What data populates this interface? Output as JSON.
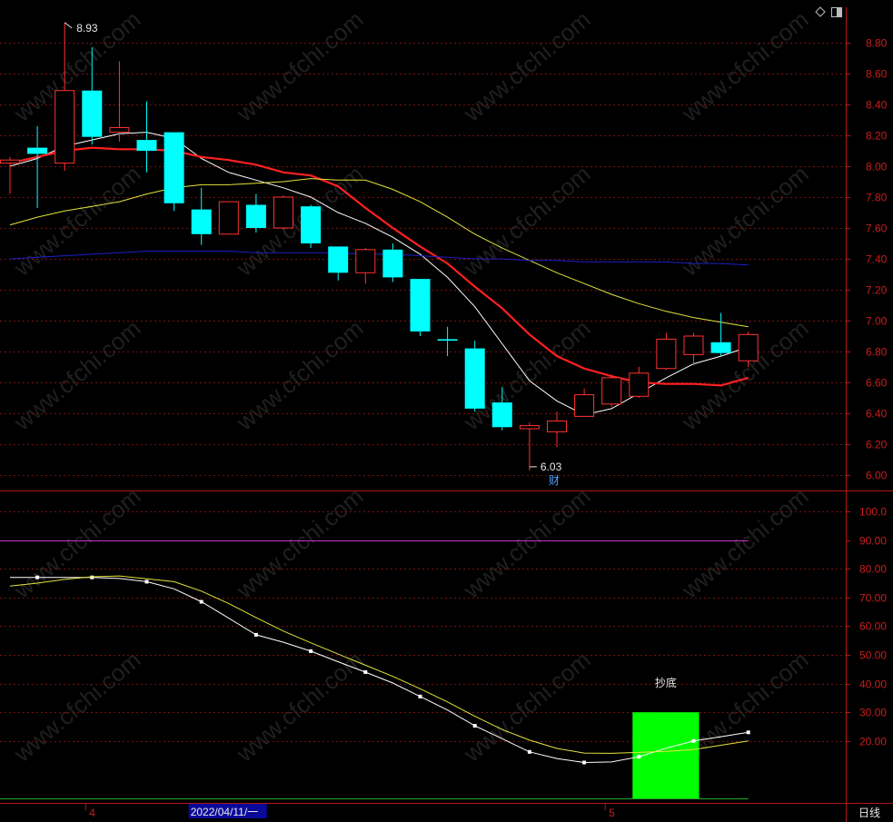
{
  "chart_data": [
    {
      "type": "candlestick",
      "y_ticks": [
        "8.80",
        "8.60",
        "8.40",
        "8.20",
        "8.00",
        "7.80",
        "7.60",
        "7.40",
        "7.20",
        "7.00",
        "6.80",
        "6.60",
        "6.40",
        "6.20",
        "6.00"
      ],
      "ylim": [
        5.97,
        9.05
      ],
      "high_label": "8.93",
      "low_label": "6.03",
      "marker_label": "财",
      "candles": [
        {
          "o": 8.02,
          "h": 8.06,
          "l": 7.82,
          "c": 8.04
        },
        {
          "o": 8.12,
          "h": 8.26,
          "l": 7.73,
          "c": 8.08
        },
        {
          "o": 8.02,
          "h": 8.93,
          "l": 7.97,
          "c": 8.49
        },
        {
          "o": 8.49,
          "h": 8.77,
          "l": 8.14,
          "c": 8.19
        },
        {
          "o": 8.22,
          "h": 8.68,
          "l": 8.16,
          "c": 8.25
        },
        {
          "o": 8.17,
          "h": 8.42,
          "l": 7.96,
          "c": 8.1
        },
        {
          "o": 8.22,
          "h": 8.22,
          "l": 7.71,
          "c": 7.76
        },
        {
          "o": 7.72,
          "h": 7.86,
          "l": 7.49,
          "c": 7.56
        },
        {
          "o": 7.56,
          "h": 7.77,
          "l": 7.56,
          "c": 7.77
        },
        {
          "o": 7.75,
          "h": 7.82,
          "l": 7.57,
          "c": 7.6
        },
        {
          "o": 7.6,
          "h": 7.81,
          "l": 7.59,
          "c": 7.8
        },
        {
          "o": 7.74,
          "h": 7.75,
          "l": 7.47,
          "c": 7.5
        },
        {
          "o": 7.48,
          "h": 7.48,
          "l": 7.26,
          "c": 7.31
        },
        {
          "o": 7.31,
          "h": 7.47,
          "l": 7.24,
          "c": 7.46
        },
        {
          "o": 7.46,
          "h": 7.5,
          "l": 7.25,
          "c": 7.28
        },
        {
          "o": 7.27,
          "h": 7.27,
          "l": 6.9,
          "c": 6.93
        },
        {
          "o": 6.88,
          "h": 6.96,
          "l": 6.77,
          "c": 6.87
        },
        {
          "o": 6.82,
          "h": 6.87,
          "l": 6.41,
          "c": 6.43
        },
        {
          "o": 6.47,
          "h": 6.57,
          "l": 6.29,
          "c": 6.31
        },
        {
          "o": 6.3,
          "h": 6.34,
          "l": 6.03,
          "c": 6.32
        },
        {
          "o": 6.28,
          "h": 6.41,
          "l": 6.18,
          "c": 6.35
        },
        {
          "o": 6.38,
          "h": 6.56,
          "l": 6.38,
          "c": 6.52
        },
        {
          "o": 6.46,
          "h": 6.65,
          "l": 6.44,
          "c": 6.63
        },
        {
          "o": 6.51,
          "h": 6.7,
          "l": 6.5,
          "c": 6.66
        },
        {
          "o": 6.69,
          "h": 6.92,
          "l": 6.68,
          "c": 6.88
        },
        {
          "o": 6.78,
          "h": 6.92,
          "l": 6.71,
          "c": 6.9
        },
        {
          "o": 6.86,
          "h": 7.05,
          "l": 6.77,
          "c": 6.79
        },
        {
          "o": 6.74,
          "h": 6.93,
          "l": 6.7,
          "c": 6.91
        }
      ],
      "series": [
        {
          "color": "#ffffff",
          "values": [
            8.0,
            8.05,
            8.13,
            8.17,
            8.21,
            8.22,
            8.18,
            8.05,
            7.96,
            7.91,
            7.86,
            7.8,
            7.7,
            7.63,
            7.54,
            7.43,
            7.28,
            7.09,
            6.85,
            6.61,
            6.48,
            6.39,
            6.43,
            6.53,
            6.63,
            6.72,
            6.77,
            6.83
          ]
        },
        {
          "color": "#ff2020",
          "values": [
            8.02,
            8.06,
            8.1,
            8.12,
            8.11,
            8.11,
            8.1,
            8.06,
            8.04,
            8.01,
            7.96,
            7.94,
            7.87,
            7.73,
            7.6,
            7.48,
            7.37,
            7.22,
            7.08,
            6.91,
            6.77,
            6.69,
            6.64,
            6.6,
            6.59,
            6.59,
            6.58,
            6.63
          ]
        },
        {
          "color": "#e4e43c",
          "values": [
            7.62,
            7.67,
            7.71,
            7.74,
            7.77,
            7.82,
            7.86,
            7.88,
            7.88,
            7.89,
            7.9,
            7.92,
            7.91,
            7.91,
            7.85,
            7.77,
            7.67,
            7.56,
            7.47,
            7.39,
            7.31,
            7.24,
            7.17,
            7.11,
            7.06,
            7.02,
            6.99,
            6.96
          ]
        },
        {
          "color": "#1e1ec8",
          "values": [
            7.4,
            7.41,
            7.42,
            7.43,
            7.44,
            7.45,
            7.45,
            7.45,
            7.45,
            7.44,
            7.44,
            7.44,
            7.44,
            7.43,
            7.43,
            7.42,
            7.41,
            7.4,
            7.4,
            7.39,
            7.39,
            7.38,
            7.38,
            7.38,
            7.38,
            7.37,
            7.37,
            7.36
          ]
        }
      ]
    },
    {
      "type": "line",
      "y_ticks": [
        "100.0",
        "90.00",
        "80.00",
        "70.00",
        "60.00",
        "50.00",
        "40.00",
        "30.00",
        "20.00"
      ],
      "ylim": [
        -0.5,
        104.5
      ],
      "ref_lines": [
        {
          "value": 90,
          "color": "#cc33cc"
        },
        {
          "value": 0,
          "color": "#22aa22"
        }
      ],
      "series": [
        {
          "color": "#ffffff",
          "marker": "square",
          "values": [
            77.0,
            77.0,
            77.0,
            77.0,
            76.6,
            75.5,
            73.0,
            68.5,
            62.8,
            57.0,
            54.4,
            51.3,
            47.6,
            44.0,
            40.2,
            35.5,
            30.8,
            25.3,
            20.8,
            16.2,
            13.9,
            12.5,
            12.7,
            14.5,
            17.5,
            20.0,
            21.5,
            23.0
          ]
        },
        {
          "color": "#e4e43c",
          "values": [
            74.0,
            75.0,
            76.3,
            77.2,
            77.5,
            76.5,
            75.5,
            72.2,
            67.9,
            63.0,
            58.3,
            54.2,
            50.3,
            46.4,
            42.5,
            38.2,
            33.6,
            28.6,
            24.0,
            20.3,
            17.4,
            15.8,
            15.7,
            16.0,
            16.4,
            17.0,
            18.5,
            20.0
          ]
        }
      ],
      "signal": {
        "label": "抄底",
        "color": "#00ff00",
        "from_index": 23,
        "to_index": 25,
        "top": 30
      }
    }
  ],
  "x_axis": {
    "labels": [
      {
        "text": "4",
        "index": 3
      },
      {
        "text": "5",
        "index": 22
      }
    ],
    "date_label": "2022/04/11/一",
    "date_index": 7,
    "period_label": "日线"
  },
  "watermark": "www.cfchi.com",
  "icons": [
    "diamond-icon",
    "panel-toggle-icon"
  ]
}
